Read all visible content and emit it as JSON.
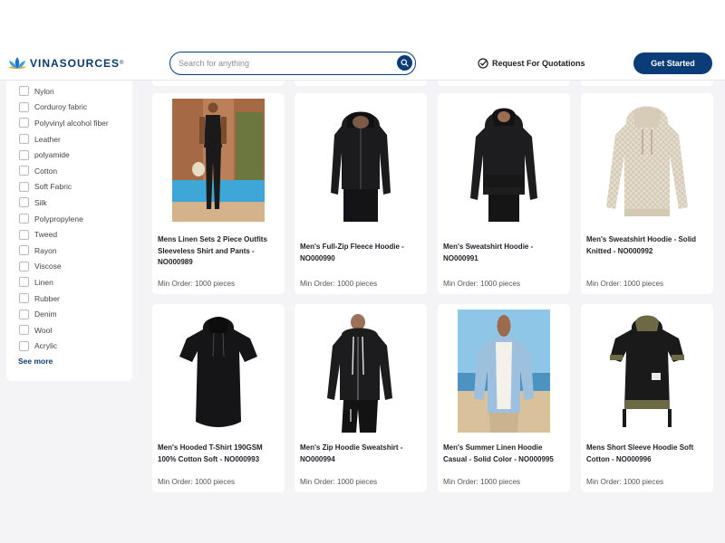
{
  "brand": {
    "name": "VINASOURCES",
    "reg": "®"
  },
  "search": {
    "placeholder": "Search for anything"
  },
  "header": {
    "rfq_label": "Request For Quotations",
    "cta_label": "Get Started"
  },
  "filters": {
    "items": [
      "Nylon",
      "Corduroy fabric",
      "Polyvinyl alcohol fiber",
      "Leather",
      "polyamide",
      "Cotton",
      "Soft Fabric",
      "Silk",
      "Polypropylene",
      "Tweed",
      "Rayon",
      "Viscose",
      "Linen",
      "Rubber",
      "Denim",
      "Wool",
      "Acrylic"
    ],
    "see_more": "See more"
  },
  "products": [
    {
      "title": "Mens Linen Sets 2 Piece Outfits Sleeveless Shirt and Pants - NO000989",
      "moq": "Min Order: 1000 pieces",
      "icon": "linen-set-photo"
    },
    {
      "title": "Men's Full-Zip Fleece Hoodie - NO000990",
      "moq": "Min Order: 1000 pieces",
      "icon": "zip-hoodie-photo"
    },
    {
      "title": "Men's Sweatshirt Hoodie - NO000991",
      "moq": "Min Order: 1000 pieces",
      "icon": "pullover-hoodie-photo"
    },
    {
      "title": "Men's Sweatshirt Hoodie - Solid Knitted - NO000992",
      "moq": "Min Order: 1000 pieces",
      "icon": "knit-hoodie-photo"
    },
    {
      "title": "Men's Hooded T-Shirt 190GSM 100% Cotton Soft - NO000993",
      "moq": "Min Order: 1000 pieces",
      "icon": "hooded-tshirt-photo"
    },
    {
      "title": "Men's Zip Hoodie Sweatshirt - NO000994",
      "moq": "Min Order: 1000 pieces",
      "icon": "zip-sweatshirt-photo"
    },
    {
      "title": "Men's Summer Linen Hoodie Casual - Solid Color - NO000995",
      "moq": "Min Order: 1000 pieces",
      "icon": "linen-hoodie-photo"
    },
    {
      "title": "Mens Short Sleeve Hoodie Soft Cotton - NO000996",
      "moq": "Min Order: 1000 pieces",
      "icon": "short-sleeve-hoodie-photo"
    }
  ],
  "colors": {
    "primary": "#0a3d78",
    "background": "#f4f4f6"
  }
}
